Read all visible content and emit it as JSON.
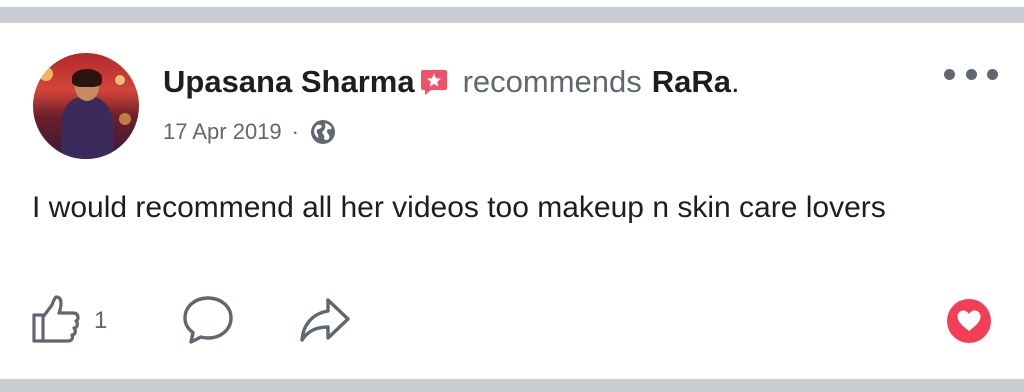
{
  "post": {
    "author_name": "Upasana Sharma",
    "verb": "recommends",
    "page_name": "RaRa",
    "period": ".",
    "date": "17 Apr 2019",
    "meta_separator": "·",
    "privacy_icon": "globe-icon",
    "recommendation_icon": "recommendation-star-icon",
    "body": "I would recommend all her videos too makeup n skin care lovers"
  },
  "actions": {
    "like_icon": "thumbs-up-icon",
    "like_count": "1",
    "comment_icon": "comment-bubble-icon",
    "share_icon": "share-arrow-icon",
    "love_icon": "heart-reaction-icon",
    "more_icon": "more-options-icon"
  },
  "colors": {
    "badge_red": "#f25268",
    "love_red": "#f33e58",
    "text_primary": "#1c1e21",
    "text_secondary": "#606770",
    "separator": "#c9ccd1"
  }
}
